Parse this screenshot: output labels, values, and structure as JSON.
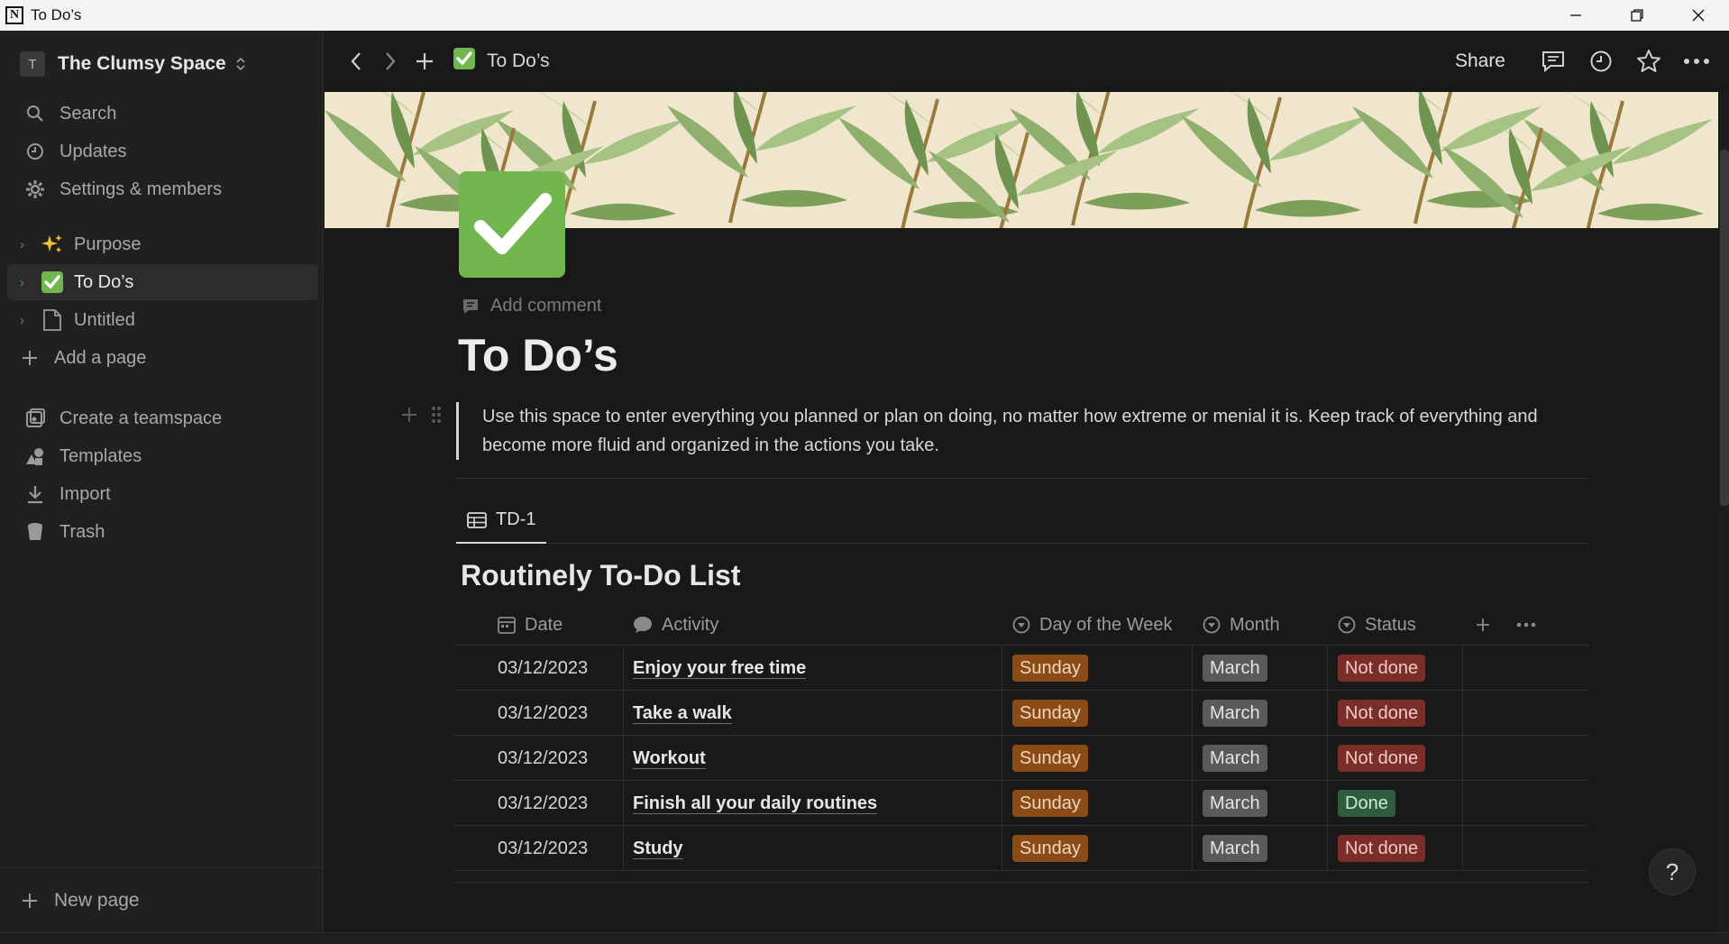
{
  "window": {
    "title": "To Do’s",
    "app_logo": "N"
  },
  "sidebar": {
    "workspace_avatar": "T",
    "workspace_name": "The Clumsy Space",
    "nav": [
      {
        "label": "Search",
        "icon": "search-icon"
      },
      {
        "label": "Updates",
        "icon": "clock-icon"
      },
      {
        "label": "Settings & members",
        "icon": "gear-icon"
      }
    ],
    "pages": [
      {
        "label": "Purpose",
        "icon": "sparkles-icon"
      },
      {
        "label": "To Do’s",
        "icon": "check-icon"
      },
      {
        "label": "Untitled",
        "icon": "document-icon"
      }
    ],
    "add_page": "Add a page",
    "tools": [
      {
        "label": "Create a teamspace",
        "icon": "teamspace-icon"
      },
      {
        "label": "Templates",
        "icon": "shapes-icon"
      },
      {
        "label": "Import",
        "icon": "download-icon"
      },
      {
        "label": "Trash",
        "icon": "trash-icon"
      }
    ],
    "new_page": "New page"
  },
  "topbar": {
    "breadcrumb": "To Do’s",
    "share": "Share"
  },
  "page": {
    "add_comment": "Add comment",
    "title": "To Do’s",
    "quote_text": "Use this space to enter everything you planned or plan on doing, no matter how extreme or menial it is. Keep track of everything and become more fluid and organized in the actions you take.",
    "view_tab": "TD-1",
    "db_title": "Routinely To-Do List"
  },
  "table": {
    "columns": {
      "date": "Date",
      "activity": "Activity",
      "dow": "Day of the Week",
      "month": "Month",
      "status": "Status"
    },
    "rows": [
      {
        "date": "03/12/2023",
        "activity": "Enjoy your free time",
        "dow": "Sunday",
        "month": "March",
        "status": "Not done",
        "status_kind": "notdone"
      },
      {
        "date": "03/12/2023",
        "activity": "Take a walk",
        "dow": "Sunday",
        "month": "March",
        "status": "Not done",
        "status_kind": "notdone"
      },
      {
        "date": "03/12/2023",
        "activity": "Workout",
        "dow": "Sunday",
        "month": "March",
        "status": "Not done",
        "status_kind": "notdone"
      },
      {
        "date": "03/12/2023",
        "activity": "Finish all your daily routines",
        "dow": "Sunday",
        "month": "March",
        "status": "Done",
        "status_kind": "done"
      },
      {
        "date": "03/12/2023",
        "activity": "Study",
        "dow": "Sunday",
        "month": "March",
        "status": "Not done",
        "status_kind": "notdone"
      }
    ]
  },
  "help_label": "?",
  "colors": {
    "background": "#191919",
    "sidebar": "#202020",
    "tag_sunday": "#8a4b16",
    "tag_month": "#5a5a5a",
    "tag_not_done": "#7a2e2a",
    "tag_done": "#2f5c3e",
    "icon_check": "#72b650"
  }
}
